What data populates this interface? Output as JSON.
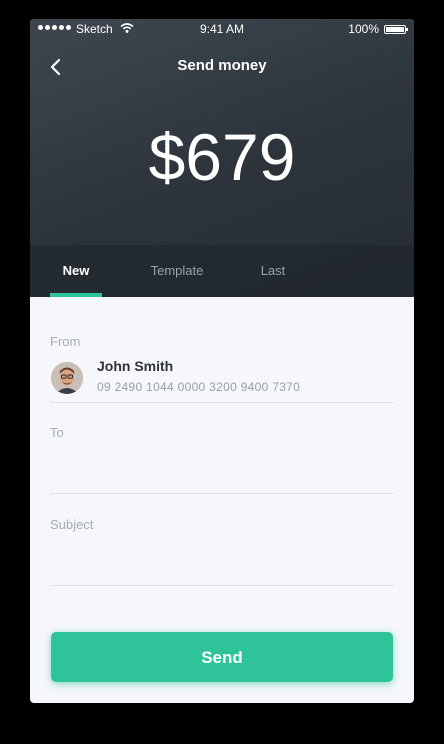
{
  "status_bar": {
    "carrier": "Sketch",
    "time": "9:41 AM",
    "battery": "100%",
    "icons": [
      "signal-icon",
      "wifi-icon",
      "battery-icon"
    ]
  },
  "header": {
    "back_icon": "chevron-left-icon",
    "title": "Send money",
    "amount": "$679"
  },
  "tabs": [
    {
      "label": "New",
      "active": true
    },
    {
      "label": "Template",
      "active": false
    },
    {
      "label": "Last",
      "active": false
    }
  ],
  "form": {
    "from_label": "From",
    "sender": {
      "name": "John Smith",
      "account": "09 2490 1044 0000 3200 9400 7370"
    },
    "to_label": "To",
    "to_value": "",
    "subject_label": "Subject",
    "subject_value": ""
  },
  "send_button": {
    "label": "Send"
  },
  "colors": {
    "accent": "#2ec398",
    "header_bg": "#2f363d",
    "form_bg": "#f5f7fb"
  }
}
